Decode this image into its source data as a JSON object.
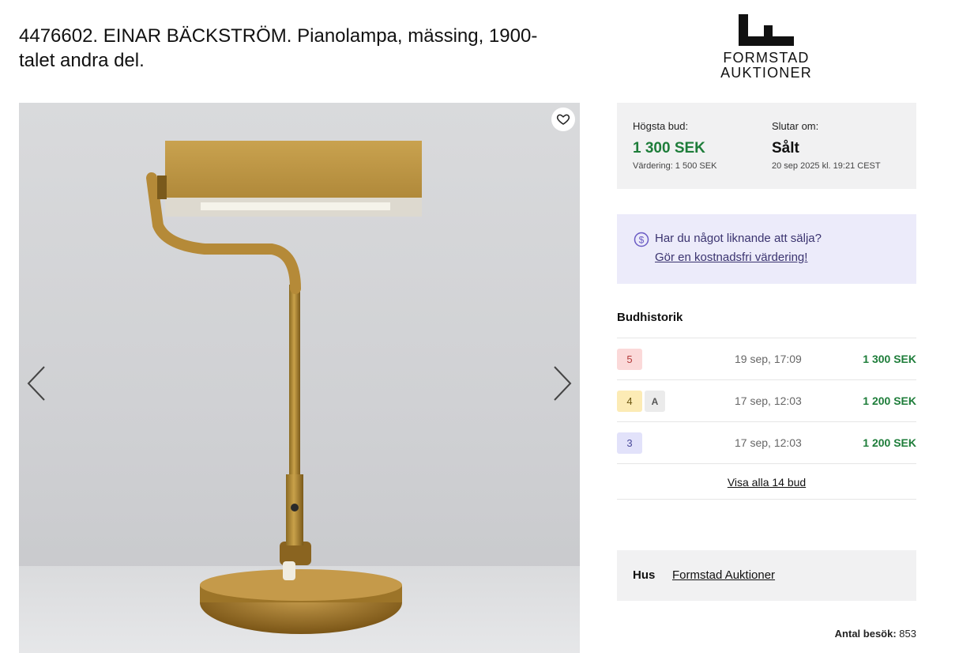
{
  "lot": {
    "title": "4476602. EINAR BÄCKSTRÖM. Pianolampa, mässing, 1900-talet andra del."
  },
  "logo": {
    "line1": "FORMSTAD",
    "line2": "AUKTIONER"
  },
  "gallery": {
    "favorite_icon": "heart-icon",
    "prev_icon": "chevron-left-icon",
    "next_icon": "chevron-right-icon"
  },
  "bid_summary": {
    "highest_label": "Högsta bud:",
    "highest_value": "1 300 SEK",
    "valuation": "Värdering: 1 500 SEK",
    "ends_label": "Slutar om:",
    "ends_value": "Sålt",
    "ends_date": "20 sep 2025 kl. 19:21 CEST",
    "accent_color": "#1e7d3a"
  },
  "sell": {
    "question": "Har du något liknande att sälja?",
    "link": "Gör en kostnadsfri värdering!",
    "icon": "dollar-circle-icon"
  },
  "bid_history": {
    "title": "Budhistorik",
    "rows": [
      {
        "bidder": "5",
        "extra": "",
        "time": "19 sep, 17:09",
        "amount": "1 300 SEK",
        "badge_bg": "#fbd9d9",
        "badge_fg": "#b33b3b"
      },
      {
        "bidder": "4",
        "extra": "A",
        "time": "17 sep, 12:03",
        "amount": "1 200 SEK",
        "badge_bg": "#fcebb5",
        "badge_fg": "#6a5410"
      },
      {
        "bidder": "3",
        "extra": "",
        "time": "17 sep, 12:03",
        "amount": "1 200 SEK",
        "badge_bg": "#e2e2fa",
        "badge_fg": "#4a4a9a"
      }
    ],
    "show_all": "Visa alla 14 bud"
  },
  "house": {
    "label": "Hus",
    "name": "Formstad Auktioner"
  },
  "visits": {
    "label": "Antal besök:",
    "count": "853"
  }
}
